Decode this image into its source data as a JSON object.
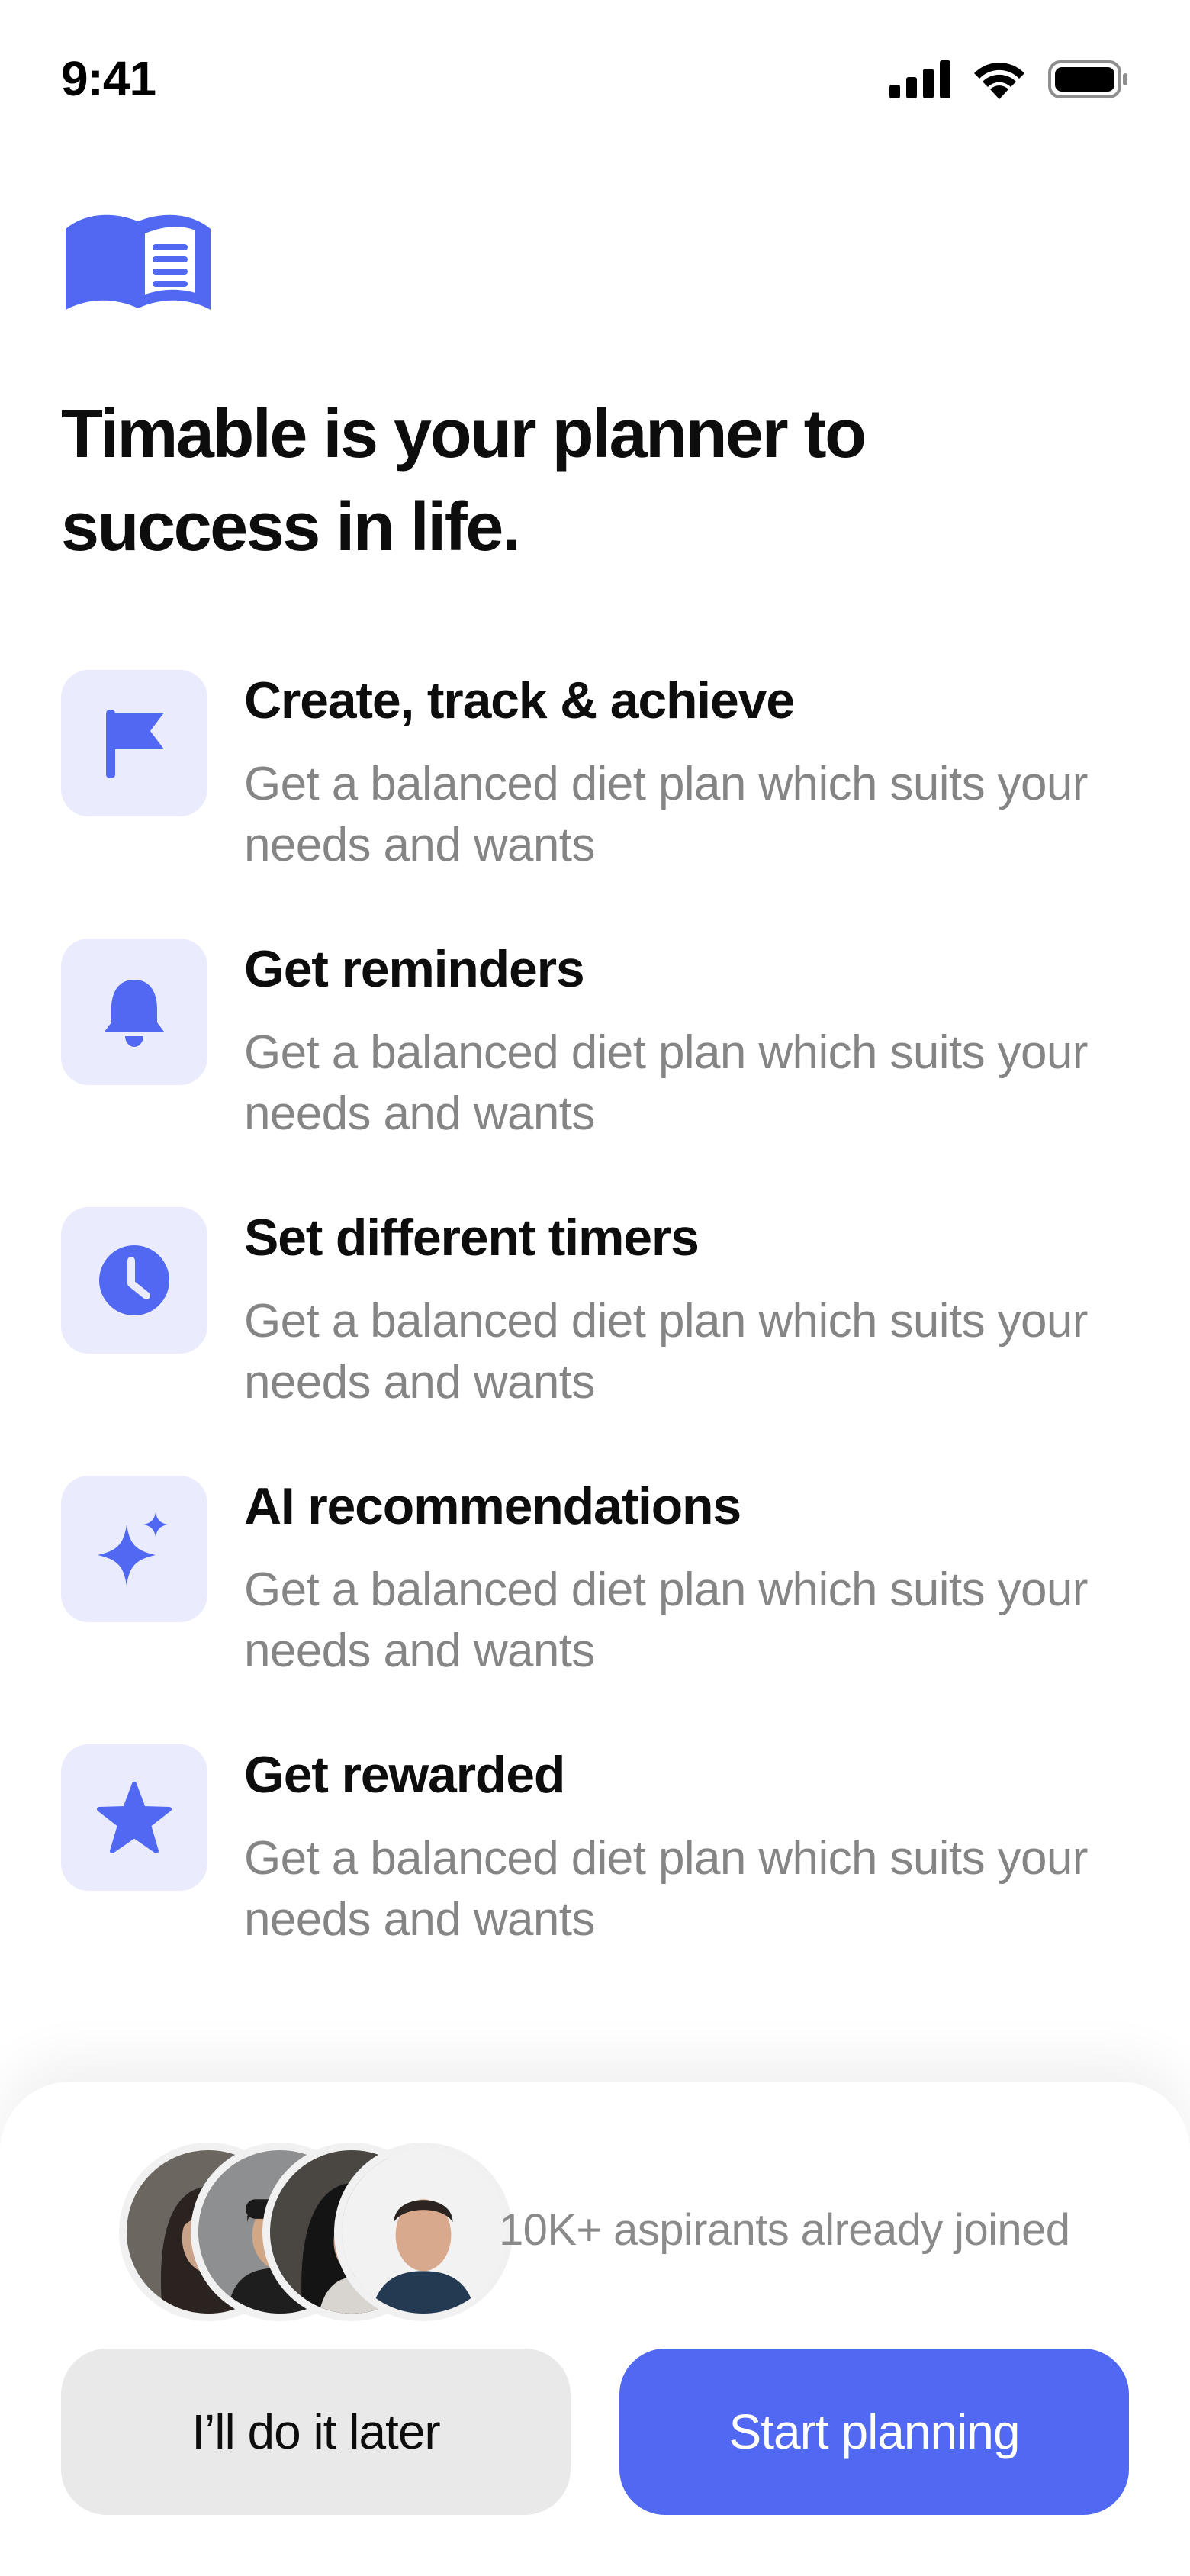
{
  "status_bar": {
    "time": "9:41"
  },
  "headline": "Timable is your planner to success in life.",
  "features": [
    {
      "icon": "flag-icon",
      "title": "Create, track & achieve",
      "description": "Get a balanced diet plan which suits your needs and wants"
    },
    {
      "icon": "bell-icon",
      "title": "Get reminders",
      "description": "Get a balanced diet plan which suits your needs and wants"
    },
    {
      "icon": "clock-icon",
      "title": "Set different timers",
      "description": "Get a balanced diet plan which suits your needs and wants"
    },
    {
      "icon": "sparkle-icon",
      "title": "AI recommendations",
      "description": "Get a balanced diet plan which suits your needs and wants"
    },
    {
      "icon": "star-icon",
      "title": "Get rewarded",
      "description": "Get a balanced diet plan which suits your needs and wants"
    }
  ],
  "social_proof": {
    "text": "10K+ aspirants already joined"
  },
  "buttons": {
    "later": "I’ll do it later",
    "start": "Start planning"
  },
  "colors": {
    "accent": "#5068f2",
    "icon_tile": "#eaecfe",
    "secondary_text": "#858585",
    "secondary_button": "#e9e9e9"
  }
}
